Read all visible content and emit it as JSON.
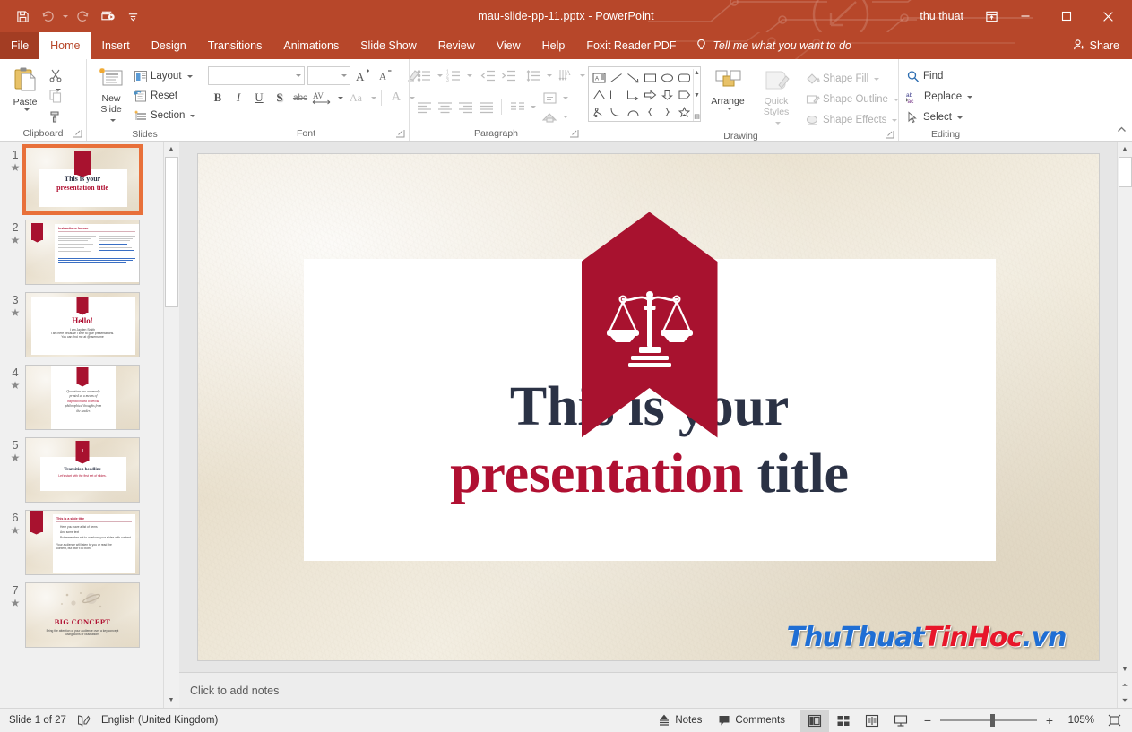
{
  "titlebar": {
    "document_title": "mau-slide-pp-11.pptx  -  PowerPoint",
    "user_name": "thu thuat",
    "quick_access": [
      {
        "name": "save-icon",
        "label": "Save"
      },
      {
        "name": "undo-icon",
        "label": "Undo"
      },
      {
        "name": "redo-icon",
        "label": "Redo"
      },
      {
        "name": "start-from-beginning-icon",
        "label": "Start From Beginning"
      },
      {
        "name": "customize-quick-access-toolbar-icon",
        "label": "Customize Quick Access Toolbar"
      }
    ],
    "ribbon_display_options": "Ribbon Display Options",
    "minimize": "Minimize",
    "maximize": "Restore Down",
    "close": "Close"
  },
  "tabs": [
    {
      "label": "File",
      "active": false,
      "kind": "file"
    },
    {
      "label": "Home",
      "active": true,
      "kind": "normal"
    },
    {
      "label": "Insert",
      "active": false,
      "kind": "normal"
    },
    {
      "label": "Design",
      "active": false,
      "kind": "normal"
    },
    {
      "label": "Transitions",
      "active": false,
      "kind": "normal"
    },
    {
      "label": "Animations",
      "active": false,
      "kind": "normal"
    },
    {
      "label": "Slide Show",
      "active": false,
      "kind": "normal"
    },
    {
      "label": "Review",
      "active": false,
      "kind": "normal"
    },
    {
      "label": "View",
      "active": false,
      "kind": "normal"
    },
    {
      "label": "Help",
      "active": false,
      "kind": "normal"
    },
    {
      "label": "Foxit Reader PDF",
      "active": false,
      "kind": "normal"
    }
  ],
  "tell_me": "Tell me what you want to do",
  "share": "Share",
  "ribbon": {
    "clipboard": {
      "group_label": "Clipboard",
      "paste": "Paste",
      "cut": "Cut",
      "copy": "Copy",
      "format_painter": "Format Painter"
    },
    "slides": {
      "group_label": "Slides",
      "new_slide": "New\nSlide",
      "new_slide_line1": "New",
      "new_slide_line2": "Slide",
      "layout": "Layout",
      "reset": "Reset",
      "section": "Section"
    },
    "font": {
      "group_label": "Font",
      "font_name_value": "",
      "font_size_value": "",
      "increase_font_size": "Increase Font Size",
      "decrease_font_size": "Decrease Font Size",
      "clear_formatting": "Clear All Formatting",
      "bold": "B",
      "italic": "I",
      "underline": "U",
      "text_shadow": "S",
      "strikethrough": "abc",
      "character_spacing": "AV",
      "change_case": "Aa",
      "font_color": "A"
    },
    "paragraph": {
      "group_label": "Paragraph",
      "bullets": "Bullets",
      "numbering": "Numbering",
      "decrease_indent": "Decrease List Level",
      "increase_indent": "Increase List Level",
      "line_spacing": "Line Spacing",
      "text_direction": "Text Direction",
      "align_text": "Align Text",
      "convert_to_smartart": "Convert to SmartArt",
      "align_left": "Align Left",
      "center": "Center",
      "align_right": "Align Right",
      "justify": "Justify",
      "columns": "Columns"
    },
    "drawing": {
      "group_label": "Drawing",
      "arrange": "Arrange",
      "quick_styles_line1": "Quick",
      "quick_styles_line2": "Styles",
      "shape_fill": "Shape Fill",
      "shape_outline": "Shape Outline",
      "shape_effects": "Shape Effects"
    },
    "editing": {
      "group_label": "Editing",
      "find": "Find",
      "replace": "Replace",
      "select": "Select"
    },
    "collapse_ribbon": "Collapse the Ribbon"
  },
  "thumbnails": [
    {
      "number": "1",
      "selected": true,
      "kind": "title",
      "title_line1": "This is your",
      "title_line2": "presentation title"
    },
    {
      "number": "2",
      "selected": false,
      "kind": "instructions",
      "heading": "Instructions for use"
    },
    {
      "number": "3",
      "selected": false,
      "kind": "hello",
      "heading": "Hello!",
      "line1": "I am Jayden Smith",
      "line2": "I am here because I love to give presentations.",
      "line3": "You can find me at @username"
    },
    {
      "number": "4",
      "selected": false,
      "kind": "quote",
      "line1": "Quotations are commonly",
      "line2": "printed as a means of",
      "line3": "inspiration and to invoke",
      "line4": "philosophical thoughts from",
      "line5": "the reader."
    },
    {
      "number": "5",
      "selected": false,
      "kind": "transition",
      "badge": "1",
      "heading": "Transition headline",
      "sub": "Let's start with the first set of slides."
    },
    {
      "number": "6",
      "selected": false,
      "kind": "bullets",
      "heading": "This is a slide title",
      "b1": "Here you have a list of items",
      "b2": "And some text",
      "b3": "But remember not to overload your slides with content",
      "note1": "Your audience will listen to you or read the",
      "note2": "content, but won't do both."
    },
    {
      "number": "7",
      "selected": false,
      "kind": "bigconcept",
      "heading": "BIG CONCEPT",
      "sub1": "Bring the attention of your audience over a key concept",
      "sub2": "using icons or illustrations"
    }
  ],
  "slide": {
    "title_line1": "This is your",
    "title_line2_red": "presentation",
    "title_line2_dark": " title",
    "banner_icon": "scales-of-justice-icon"
  },
  "watermark": {
    "part1": "ThuThuat",
    "part2": "TinHoc",
    "part3": ".vn"
  },
  "notes": {
    "placeholder": "Click to add notes"
  },
  "status": {
    "slide_count": "Slide 1 of 27",
    "language": "English (United Kingdom)",
    "spellcheck_icon": "spellcheck-icon",
    "notes": "Notes",
    "comments": "Comments",
    "views": [
      {
        "name": "normal-view",
        "label": "Normal",
        "active": true
      },
      {
        "name": "slide-sorter-view",
        "label": "Slide Sorter",
        "active": false
      },
      {
        "name": "reading-view",
        "label": "Reading View",
        "active": false
      },
      {
        "name": "slide-show-view",
        "label": "Slide Show",
        "active": false
      }
    ],
    "zoom_out": "−",
    "zoom_in": "+",
    "zoom_level": "105%",
    "fit_to_window": "Fit slide to current window"
  },
  "colors": {
    "ribbon_orange": "#b7472a",
    "file_tab": "#a33d23",
    "selection_orange": "#e8703a",
    "banner_red": "#a8122f",
    "title_dark": "#2b3245",
    "title_red": "#b01032",
    "paper_beige": "#ece4d3",
    "watermark_blue": "#1f6ed4",
    "watermark_red": "#e8162a"
  }
}
